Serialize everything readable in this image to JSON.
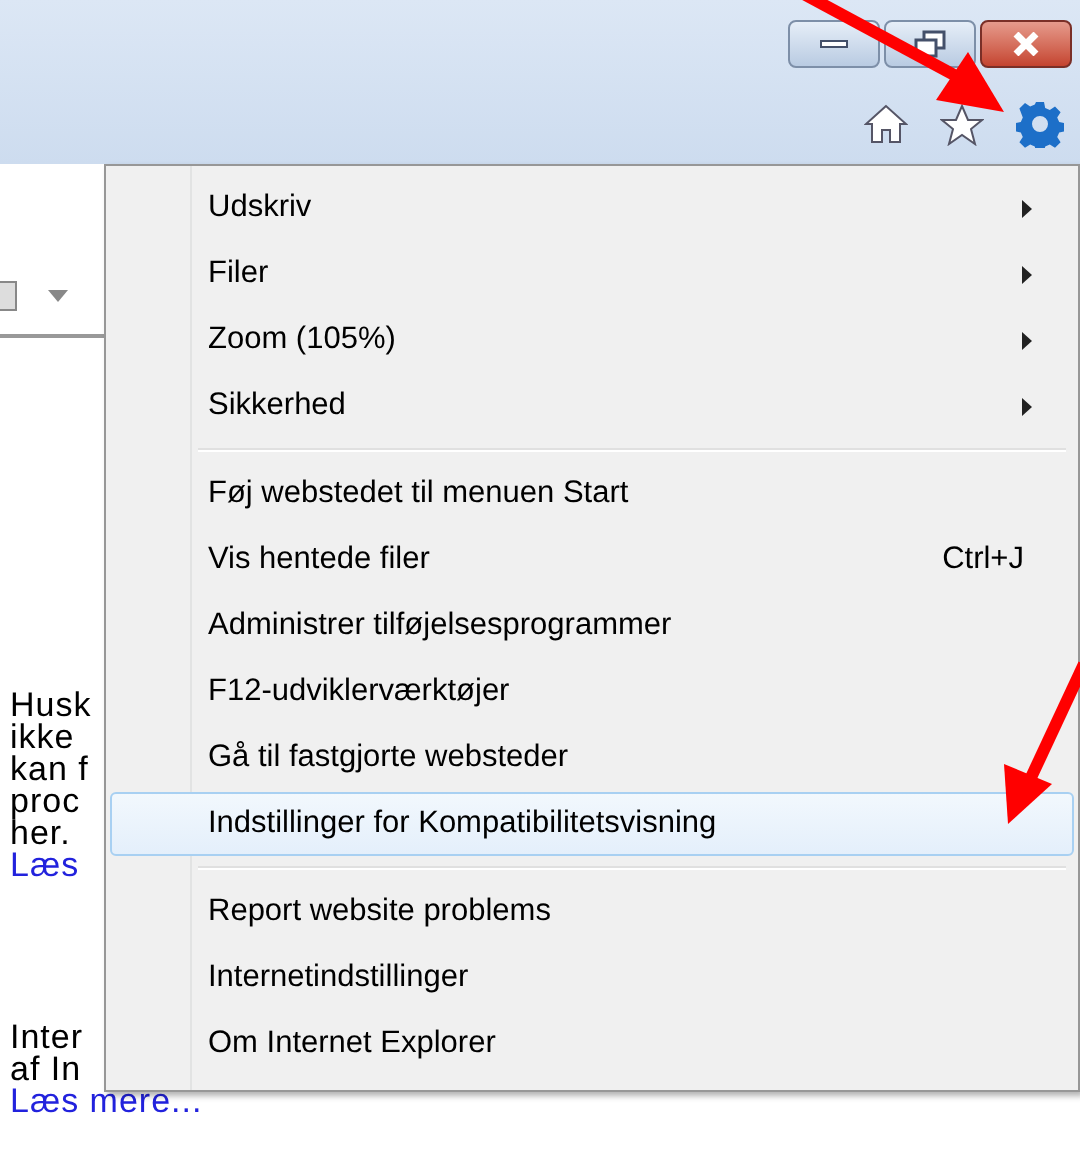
{
  "menu": {
    "items": [
      {
        "kind": "item",
        "label": "Udskriv",
        "submenu": true,
        "selected": false
      },
      {
        "kind": "item",
        "label": "Filer",
        "submenu": true,
        "selected": false
      },
      {
        "kind": "item",
        "label": "Zoom (105%)",
        "submenu": true,
        "selected": false
      },
      {
        "kind": "item",
        "label": "Sikkerhed",
        "submenu": true,
        "selected": false
      },
      {
        "kind": "separator"
      },
      {
        "kind": "item",
        "label": "Føj webstedet til menuen Start",
        "submenu": false,
        "selected": false
      },
      {
        "kind": "item",
        "label": "Vis hentede filer",
        "shortcut": "Ctrl+J",
        "submenu": false,
        "selected": false
      },
      {
        "kind": "item",
        "label": "Administrer tilføjelsesprogrammer",
        "submenu": false,
        "selected": false
      },
      {
        "kind": "item",
        "label": "F12-udviklerværktøjer",
        "submenu": false,
        "selected": false
      },
      {
        "kind": "item",
        "label": "Gå til fastgjorte websteder",
        "submenu": false,
        "selected": false
      },
      {
        "kind": "item",
        "label": "Indstillinger for Kompatibilitetsvisning",
        "submenu": false,
        "selected": true
      },
      {
        "kind": "separator"
      },
      {
        "kind": "item",
        "label": "Report website problems",
        "submenu": false,
        "selected": false
      },
      {
        "kind": "item",
        "label": "Internetindstillinger",
        "submenu": false,
        "selected": false
      },
      {
        "kind": "item",
        "label": "Om Internet Explorer",
        "submenu": false,
        "selected": false
      }
    ]
  },
  "page": {
    "blocks": [
      {
        "lines": [
          "Husk",
          "ikke",
          "kan f",
          "proc",
          "her."
        ],
        "link": "Læs"
      },
      {
        "lines": [
          "Inter",
          "af In"
        ],
        "link": "Læs mere..."
      }
    ]
  }
}
